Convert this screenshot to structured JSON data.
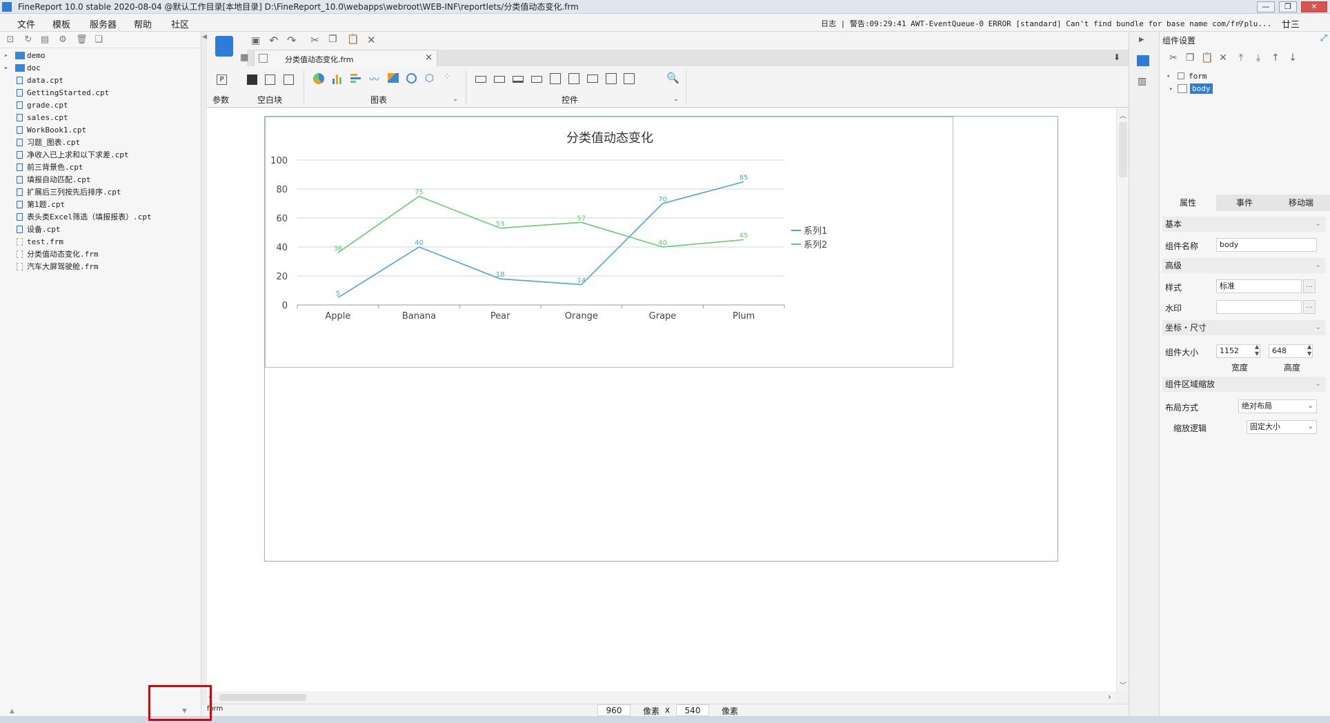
{
  "window": {
    "title": "FineReport 10.0 stable 2020-08-04 @默认工作目录[本地目录]    D:\\FineReport_10.0\\webapps\\webroot\\WEB-INF\\reportlets/分类值动态变化.frm",
    "min": "—",
    "max": "❐",
    "close": "✕"
  },
  "menu": {
    "items": [
      "文件",
      "模板",
      "服务器",
      "帮助",
      "社区"
    ]
  },
  "log": {
    "text": "日志 | 警告:09:29:41 AWT-EventQueue-0 ERROR [standard] Can't find bundle for base name com/fr/plu...",
    "user": "廿三"
  },
  "file_tree": [
    {
      "name": "demo",
      "type": "folder"
    },
    {
      "name": "doc",
      "type": "folder"
    },
    {
      "name": "data.cpt",
      "type": "cpt"
    },
    {
      "name": "GettingStarted.cpt",
      "type": "cpt"
    },
    {
      "name": "grade.cpt",
      "type": "cpt"
    },
    {
      "name": "sales.cpt",
      "type": "cpt"
    },
    {
      "name": "WorkBook1.cpt",
      "type": "cpt"
    },
    {
      "name": "习题_图表.cpt",
      "type": "cpt"
    },
    {
      "name": "净收入已上求和以下求差.cpt",
      "type": "cpt"
    },
    {
      "name": "前三背景色.cpt",
      "type": "cpt"
    },
    {
      "name": "填报自动匹配.cpt",
      "type": "cpt"
    },
    {
      "name": "扩展后三列按先后排序.cpt",
      "type": "cpt"
    },
    {
      "name": "第1题.cpt",
      "type": "cpt"
    },
    {
      "name": "表头类Excel筛选（填报报表）.cpt",
      "type": "cpt"
    },
    {
      "name": "设备.cpt",
      "type": "cpt"
    },
    {
      "name": "test.frm",
      "type": "frm"
    },
    {
      "name": "分类值动态变化.frm",
      "type": "frm"
    },
    {
      "name": "汽车大屏驾驶舱.frm",
      "type": "frm"
    }
  ],
  "editor": {
    "tab_label": "分类值动态变化.frm",
    "tab_close": "×",
    "groups": {
      "param": "参数",
      "blank": "空白块",
      "chart": "图表",
      "widget": "控件"
    }
  },
  "chart_data": {
    "type": "line",
    "title": "分类值动态变化",
    "categories": [
      "Apple",
      "Banana",
      "Pear",
      "Orange",
      "Grape",
      "Plum"
    ],
    "series": [
      {
        "name": "系列1",
        "values": [
          5,
          40,
          18,
          14,
          70,
          85
        ],
        "color": "#4aa3df"
      },
      {
        "name": "系列2",
        "values": [
          36,
          75,
          53,
          57,
          40,
          45
        ],
        "color": "#5fcf6e"
      }
    ],
    "ylim": [
      0,
      100
    ],
    "yticks": [
      0,
      20,
      40,
      60,
      80,
      100
    ],
    "grid": true,
    "legend": "right"
  },
  "status": {
    "left": "form",
    "width": "960",
    "unit1": "像素",
    "x": "x",
    "height": "540",
    "unit2": "像素"
  },
  "right_panel": {
    "header": "组件设置",
    "tree": {
      "root": "form",
      "child": "body"
    },
    "tabs": [
      "属性",
      "事件",
      "移动端"
    ],
    "sections": {
      "basic": "基本",
      "advanced": "高级",
      "coord": "坐标・尺寸",
      "zoom": "组件区域缩放"
    },
    "props": {
      "name_label": "组件名称",
      "name_value": "body",
      "style_label": "样式",
      "style_value": "标准",
      "watermark_label": "水印",
      "watermark_value": "",
      "size_label": "组件大小",
      "width_value": "1152",
      "height_value": "648",
      "width_caption": "宽度",
      "height_caption": "高度",
      "layout_label": "布局方式",
      "layout_value": "绝对布局",
      "scale_label": "缩放逻辑",
      "scale_value": "固定大小"
    }
  }
}
